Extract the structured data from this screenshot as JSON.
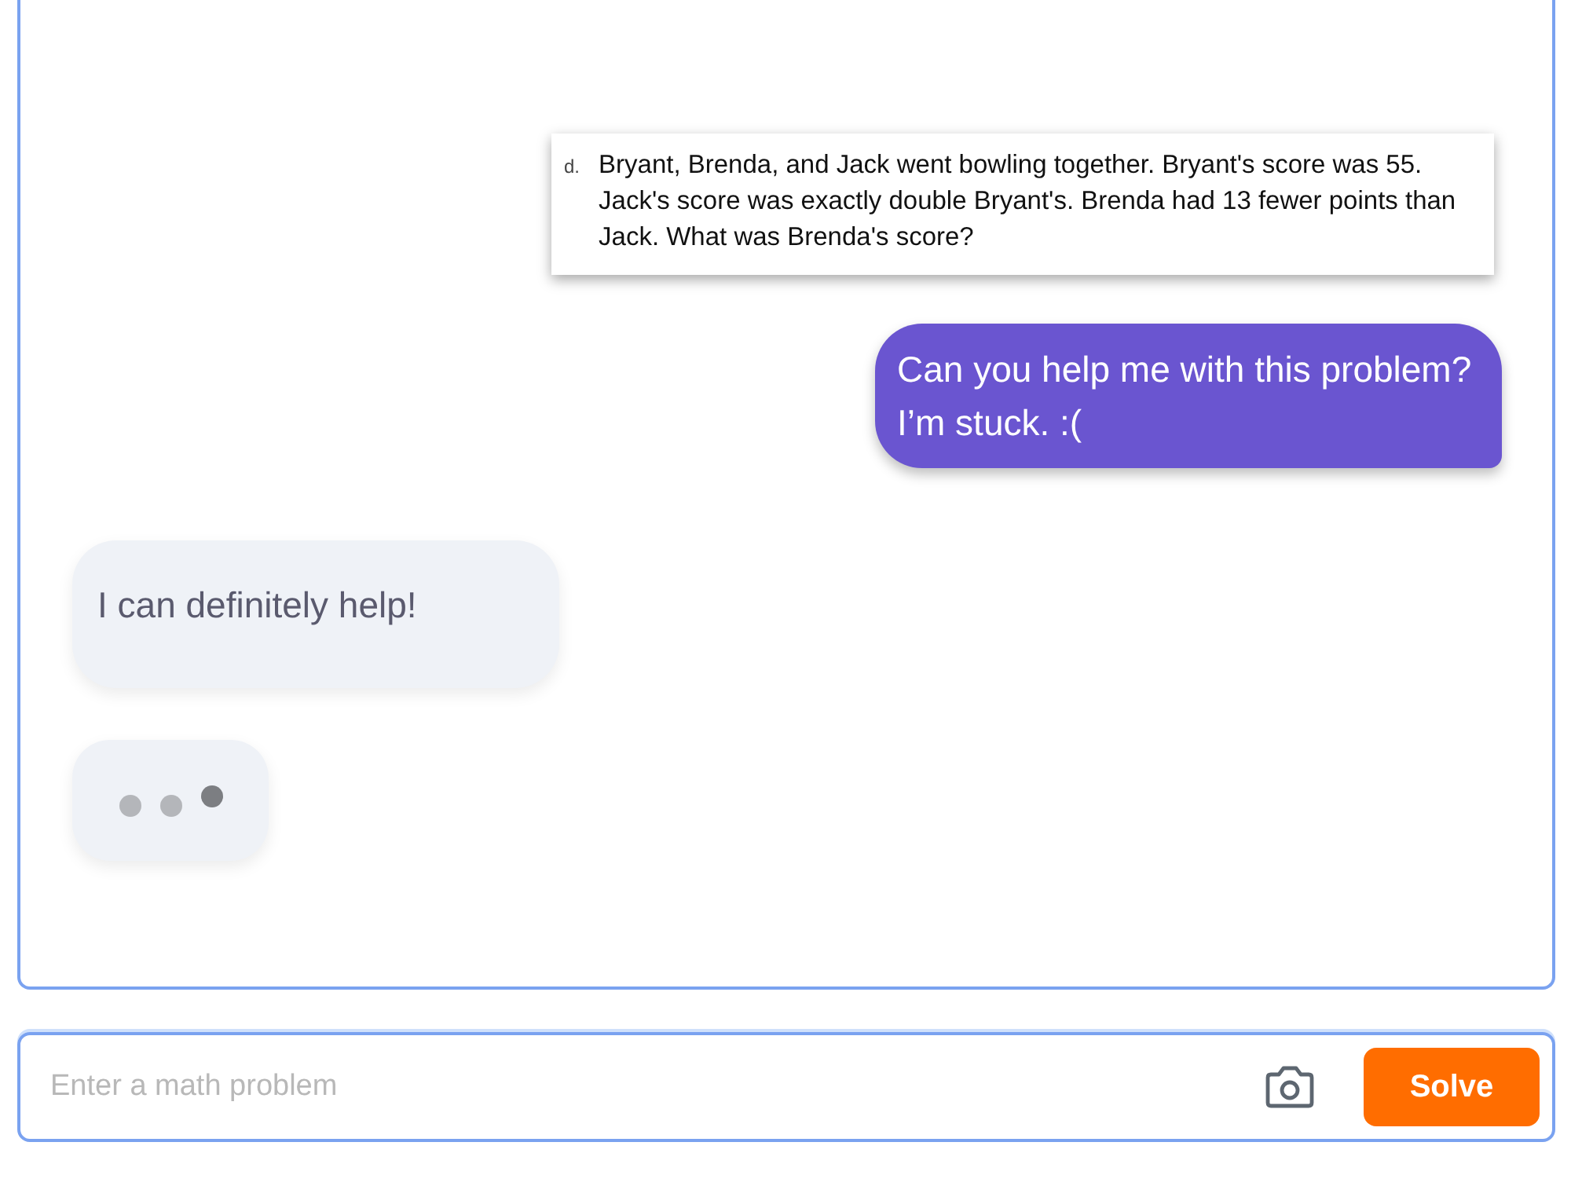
{
  "messages": [
    {
      "kind": "problem",
      "label": "d.",
      "text": "Bryant, Brenda, and Jack went bowling together.  Bryant's score was 55.  Jack's score was exactly double Bryant's. Brenda had 13 fewer points than Jack.  What was Brenda's score?"
    },
    {
      "kind": "user",
      "text": "Can you help me with this problem? I’m stuck. :("
    },
    {
      "kind": "bot",
      "text": "I can definitely help!"
    },
    {
      "kind": "typing"
    }
  ],
  "input": {
    "placeholder": "Enter a math problem"
  },
  "solve_button": {
    "label": "Solve"
  }
}
